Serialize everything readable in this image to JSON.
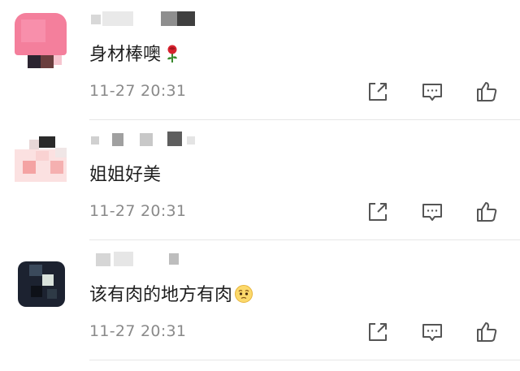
{
  "comments": [
    {
      "text": "身材棒噢",
      "emoji": "rose-emoji",
      "timestamp": "11-27 20:31"
    },
    {
      "text": "姐姐好美",
      "emoji": "",
      "timestamp": "11-27 20:31"
    },
    {
      "text": "该有肉的地方有肉",
      "emoji": "pleading-face-emoji",
      "timestamp": "11-27 20:31"
    }
  ],
  "actions": {
    "share_icon": "share-icon",
    "reply_icon": "comment-icon",
    "like_icon": "thumbs-up-icon"
  },
  "colors": {
    "text": "#1f1f1f",
    "meta": "#8a8a8a",
    "icon": "#555555",
    "divider": "#e6e6e6"
  }
}
